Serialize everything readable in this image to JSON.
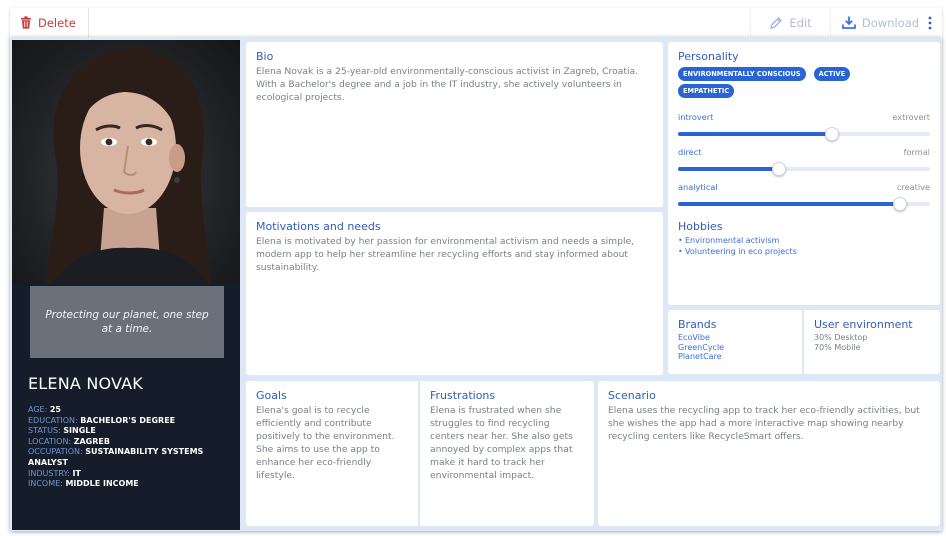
{
  "toolbar": {
    "delete_label": "Delete",
    "edit_label": "Edit",
    "download_label": "Download"
  },
  "profile": {
    "quote": "Protecting our planet, one step at a time.",
    "name": "ELENA NOVAK",
    "facts": [
      {
        "label": "AGE:",
        "value": "25"
      },
      {
        "label": "EDUCATION:",
        "value": "BACHELOR'S DEGREE"
      },
      {
        "label": "STATUS:",
        "value": "SINGLE"
      },
      {
        "label": "LOCATION:",
        "value": "ZAGREB"
      },
      {
        "label": "OCCUPATION:",
        "value": "SUSTAINABILITY SYSTEMS ANALYST"
      },
      {
        "label": "INDUSTRY:",
        "value": "IT"
      },
      {
        "label": "INCOME:",
        "value": "MIDDLE INCOME"
      }
    ]
  },
  "bio": {
    "title": "Bio",
    "text": "Elena Novak is a 25-year-old environmentally-conscious activist in Zagreb, Croatia. With a Bachelor's degree and a job in the IT industry, she actively volunteers in ecological projects."
  },
  "motivations": {
    "title": "Motivations and needs",
    "text": "Elena is motivated by her passion for environmental activism and needs a simple, modern app to help her streamline her recycling efforts and stay informed about sustainability."
  },
  "personality": {
    "title": "Personality",
    "tags": [
      "ENVIRONMENTALLY CONSCIOUS",
      "ACTIVE",
      "EMPATHETIC"
    ],
    "sliders": [
      {
        "left": "introvert",
        "right": "extrovert",
        "value": 0.61
      },
      {
        "left": "direct",
        "right": "formal",
        "value": 0.4
      },
      {
        "left": "analytical",
        "right": "creative",
        "value": 0.88
      }
    ]
  },
  "hobbies": {
    "title": "Hobbies",
    "items": [
      "Environmental activism",
      "Volunteering in eco projects"
    ]
  },
  "brands": {
    "title": "Brands",
    "items": [
      "EcoVibe",
      "GreenCycle",
      "PlanetCare"
    ]
  },
  "user_environment": {
    "title": "User environment",
    "items": [
      "30% Desktop",
      "70% Mobile"
    ]
  },
  "goals": {
    "title": "Goals",
    "text": "Elena's goal is to recycle efficiently and contribute positively to the environment. She aims to use the app to enhance her eco-friendly lifestyle."
  },
  "frustrations": {
    "title": "Frustrations",
    "text": "Elena is frustrated when she struggles to find recycling centers near her. She also gets annoyed by complex apps that make it hard to track her environmental impact."
  },
  "scenario": {
    "title": "Scenario",
    "text": "Elena uses the recycling app to track her eco-friendly activities, but she wishes the app had a more interactive map showing nearby recycling centers like RecycleSmart offers."
  },
  "colors": {
    "accent": "#2864d3",
    "heading": "#2f5db8",
    "delete": "#c83a3a",
    "panel_dark": "#151d2a",
    "board": "#dde8f7"
  }
}
